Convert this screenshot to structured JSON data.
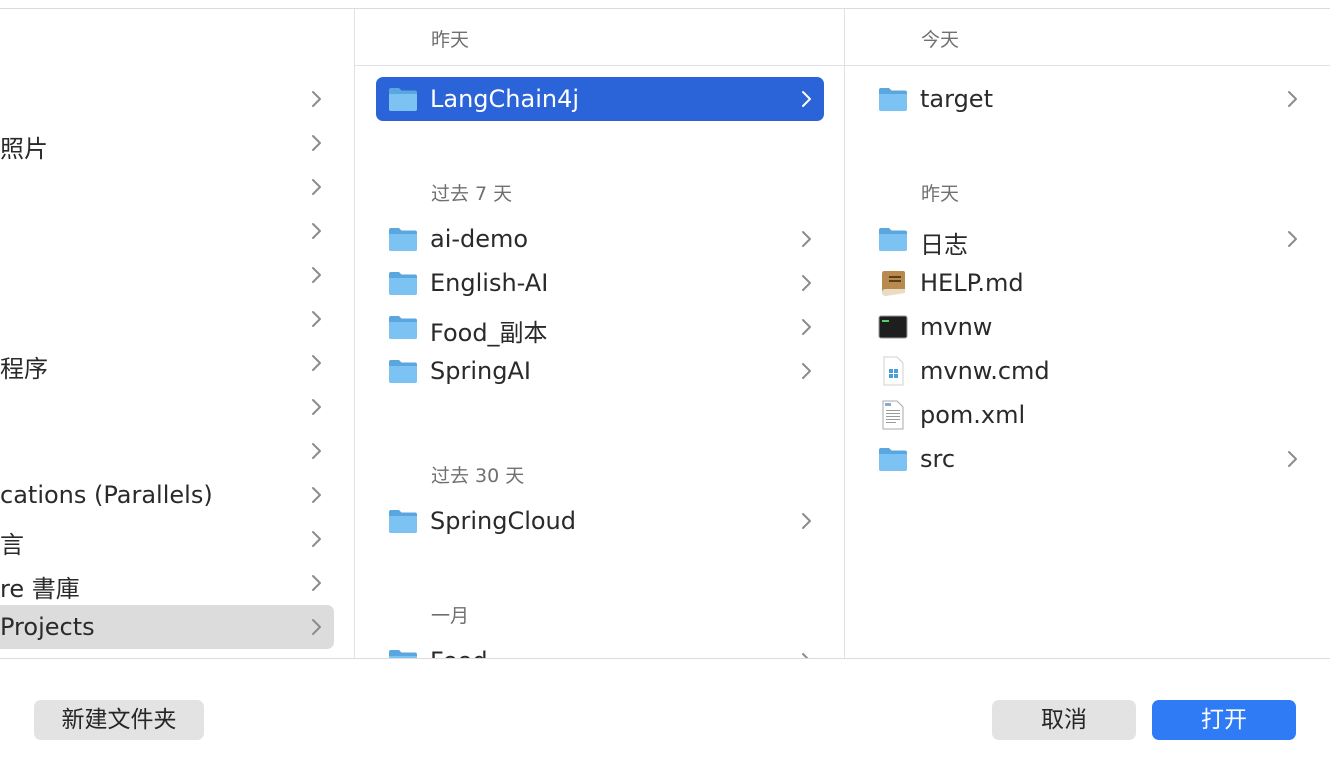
{
  "sidebar_column": {
    "items": [
      {
        "label": ""
      },
      {
        "label": "照片"
      },
      {
        "label": ""
      },
      {
        "label": ""
      },
      {
        "label": ""
      },
      {
        "label": ""
      },
      {
        "label": "程序"
      },
      {
        "label": ""
      },
      {
        "label": ""
      },
      {
        "label": "cations (Parallels)"
      },
      {
        "label": "言"
      },
      {
        "label": "re 書庫"
      },
      {
        "label": "Projects"
      }
    ]
  },
  "middle_column": {
    "header": "昨天",
    "groups": [
      {
        "label": "",
        "items": [
          {
            "label": "LangChain4j",
            "icon": "folder-icon"
          }
        ]
      },
      {
        "label": "过去 7 天",
        "items": [
          {
            "label": "ai-demo",
            "icon": "folder-icon"
          },
          {
            "label": "English-AI",
            "icon": "folder-icon"
          },
          {
            "label": "Food_副本",
            "icon": "folder-icon"
          },
          {
            "label": "SpringAI",
            "icon": "folder-icon"
          }
        ]
      },
      {
        "label": "过去 30 天",
        "items": [
          {
            "label": "SpringCloud",
            "icon": "folder-icon"
          }
        ]
      },
      {
        "label": "一月",
        "items": [
          {
            "label": "Food",
            "icon": "folder-icon"
          }
        ]
      }
    ]
  },
  "right_column": {
    "header": "今天",
    "groups": [
      {
        "label": "",
        "items": [
          {
            "label": "target",
            "icon": "folder-icon"
          }
        ]
      },
      {
        "label": "昨天",
        "items": [
          {
            "label": "日志",
            "icon": "folder-icon"
          },
          {
            "label": "HELP.md",
            "icon": "book-icon"
          },
          {
            "label": "mvnw",
            "icon": "terminal-icon"
          },
          {
            "label": "mvnw.cmd",
            "icon": "windows-file-icon"
          },
          {
            "label": "pom.xml",
            "icon": "document-icon"
          },
          {
            "label": "src",
            "icon": "folder-icon"
          }
        ]
      }
    ]
  },
  "footer": {
    "new_folder_label": "新建文件夹",
    "cancel_label": "取消",
    "open_label": "打开"
  },
  "colors": {
    "selection": "#2a64d8",
    "open_button": "#2f7bf5",
    "folder": "#6cb8ef"
  }
}
